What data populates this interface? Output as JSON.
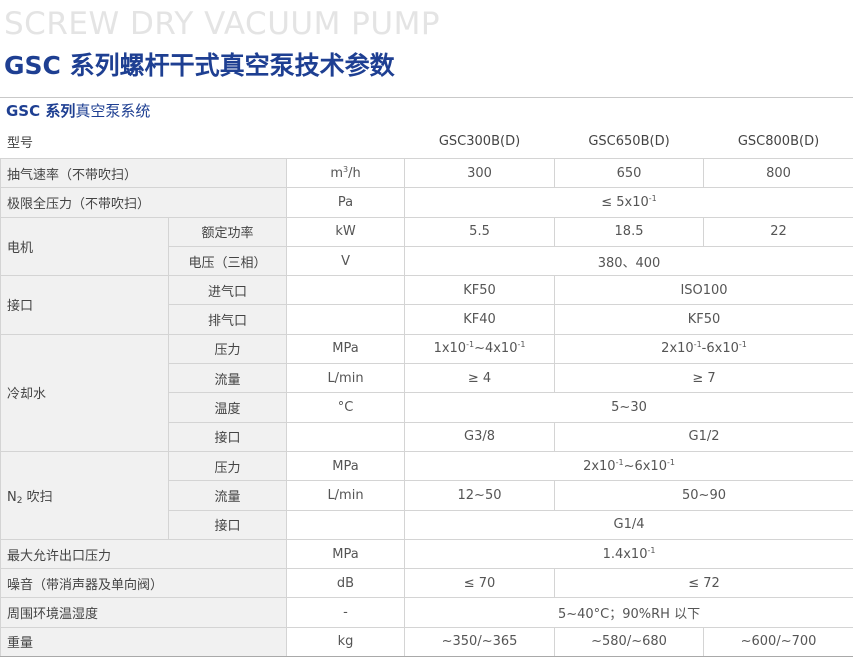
{
  "header": {
    "bg_title": "SCREW DRY VACUUM PUMP",
    "title": "GSC 系列螺杆干式真空泵技术参数"
  },
  "section": {
    "title_bold": "GSC 系列",
    "title_rest": "真空泵系统"
  },
  "table": {
    "head": {
      "label": "型号",
      "models": [
        "GSC300B(D)",
        "GSC650B(D)",
        "GSC800B(D)"
      ]
    },
    "pumping_speed": {
      "label": "抽气速率（不带吹扫）",
      "unit_base": "m",
      "unit_exp": "3",
      "unit_tail": "/h",
      "values": [
        "300",
        "650",
        "800"
      ]
    },
    "ultimate_pressure": {
      "label": "极限全压力（不带吹扫）",
      "unit": "Pa",
      "value_base": "≤ 5x10",
      "value_exp": "-1"
    },
    "motor": {
      "label": "电机",
      "power": {
        "label": "额定功率",
        "unit": "kW",
        "values": [
          "5.5",
          "18.5",
          "22"
        ]
      },
      "voltage": {
        "label": "电压（三相）",
        "unit": "V",
        "value": "380、400"
      }
    },
    "ports": {
      "label": "接口",
      "inlet": {
        "label": "进气口",
        "values": [
          "KF50",
          "ISO100"
        ]
      },
      "outlet": {
        "label": "排气口",
        "values": [
          "KF40",
          "KF50"
        ]
      }
    },
    "cooling": {
      "label": "冷却水",
      "pressure": {
        "label": "压力",
        "unit": "MPa",
        "v1_a": "1x10",
        "v1_a_exp": "-1",
        "v1_b": "~4x10",
        "v1_b_exp": "-1",
        "v2_a": "2x10",
        "v2_a_exp": "-1",
        "v2_b": "-6x10",
        "v2_b_exp": "-1"
      },
      "flow": {
        "label": "流量",
        "unit": "L/min",
        "values": [
          "≥ 4",
          "≥ 7"
        ]
      },
      "temp": {
        "label": "温度",
        "unit": "°C",
        "value": "5~30"
      },
      "port": {
        "label": "接口",
        "values": [
          "G3/8",
          "G1/2"
        ]
      }
    },
    "n2": {
      "label_base": "N",
      "label_sub": "2",
      "label_rest": " 吹扫",
      "pressure": {
        "label": "压力",
        "unit": "MPa",
        "v_a": "2x10",
        "v_a_exp": "-1",
        "v_b": "~6x10",
        "v_b_exp": "-1"
      },
      "flow": {
        "label": "流量",
        "unit": "L/min",
        "values": [
          "12~50",
          "50~90"
        ]
      },
      "port": {
        "label": "接口",
        "value": "G1/4"
      }
    },
    "max_outlet": {
      "label": "最大允许出口压力",
      "unit": "MPa",
      "value_base": "1.4x10",
      "value_exp": "-1"
    },
    "noise": {
      "label": "噪音（带消声器及单向阀）",
      "unit": "dB",
      "values": [
        "≤ 70",
        "≤ 72"
      ]
    },
    "environment": {
      "label": "周围环境温湿度",
      "unit": "-",
      "value": "5~40°C；90%RH 以下"
    },
    "weight": {
      "label": "重量",
      "unit": "kg",
      "values": [
        "~350/~365",
        "~580/~680",
        "~600/~700"
      ]
    }
  }
}
